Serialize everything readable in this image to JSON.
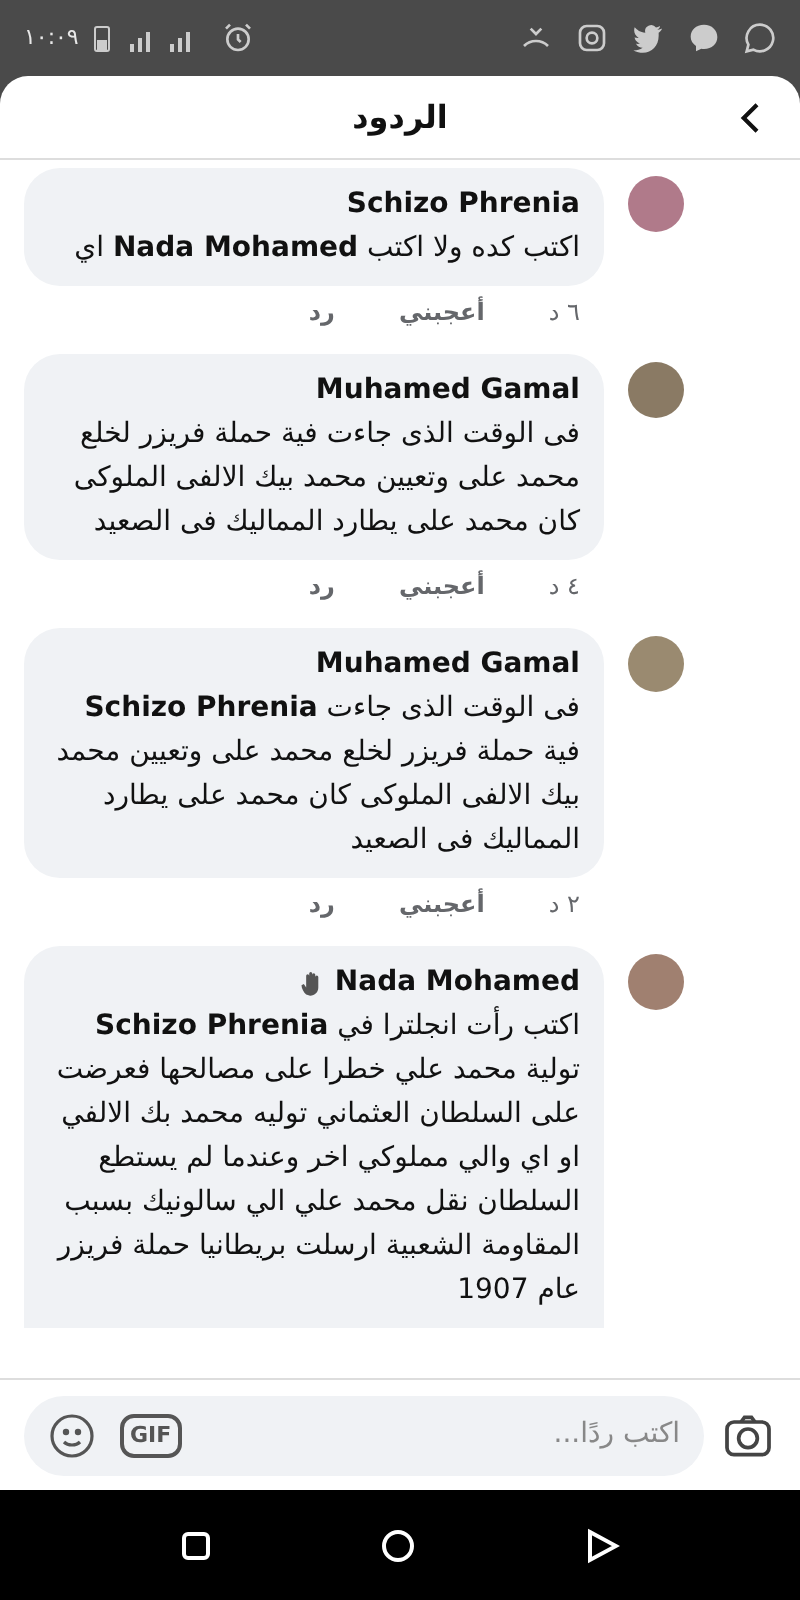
{
  "status_bar": {
    "time": "١٠:٠٩"
  },
  "header": {
    "title": "الردود"
  },
  "comments": [
    {
      "author": "Schizo Phrenia",
      "wave": false,
      "text": "اكتب كده ولا اكتب **Nada Mohamed** اي",
      "time": "٦ د",
      "like": "أعجبني",
      "reply": "رد"
    },
    {
      "author": "Muhamed Gamal",
      "wave": false,
      "text": "فى الوقت الذى جاءت فية حملة فريزر لخلع محمد على وتعيين محمد بيك الالفى الملوكى كان محمد على يطارد المماليك فى الصعيد",
      "time": "٤ د",
      "like": "أعجبني",
      "reply": "رد"
    },
    {
      "author": "Muhamed Gamal",
      "wave": false,
      "text": "فى الوقت الذى جاءت **Schizo Phrenia** فية حملة فريزر لخلع محمد على وتعيين محمد بيك الالفى الملوكى كان محمد على يطارد المماليك فى الصعيد",
      "time": "٢ د",
      "like": "أعجبني",
      "reply": "رد"
    },
    {
      "author": "Nada Mohamed",
      "wave": true,
      "text": "اكتب رأت انجلترا في **Schizo Phrenia** تولية محمد علي خطرا على مصالحها فعرضت على السلطان العثماني توليه محمد بك الالفي او اي والي مملوكي اخر وعندما لم يستطع السلطان نقل محمد علي الي سالونيك بسبب المقاومة الشعبية ارسلت بريطانيا حملة فريزر عام 1907"
    }
  ],
  "composer": {
    "placeholder": "اكتب ردًا...",
    "gif": "GIF"
  }
}
